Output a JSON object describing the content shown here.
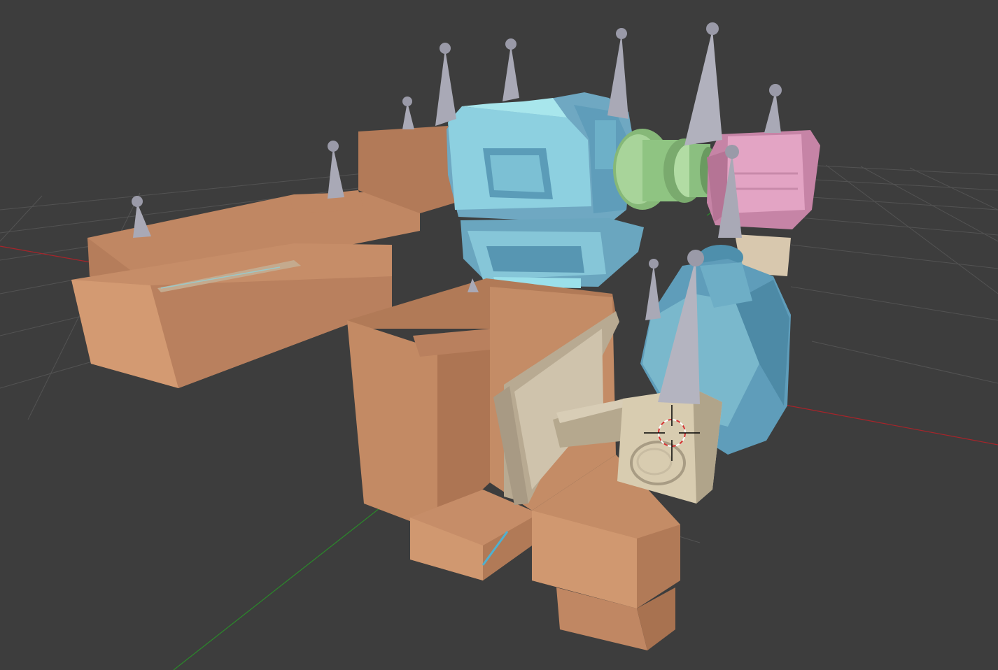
{
  "viewport": {
    "background": "#3d3d3d",
    "grid_color": "#545454",
    "x_axis_color": "#b2242a",
    "y_axis_color": "#2a8a2a"
  },
  "materials": {
    "body": "#c8906a",
    "head": "#7ec8dc",
    "neck": "#9ccc8a",
    "pink_part": "#e3a4c4",
    "shoulder": "#78b4cc",
    "cannon": "#c6b8a0",
    "spike": "#a9a9b6"
  },
  "cursor": {
    "icon": "3d-cursor-icon",
    "ring_color": "#d43030"
  }
}
